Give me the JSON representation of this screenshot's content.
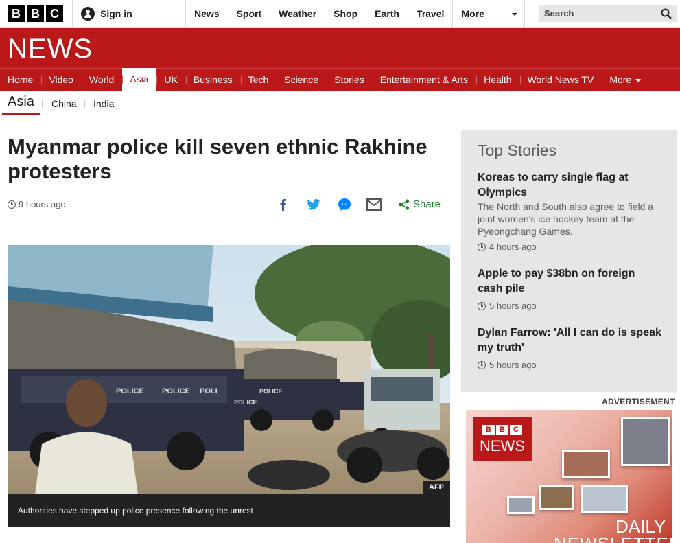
{
  "header": {
    "logo_letters": [
      "B",
      "B",
      "C"
    ],
    "sign_in": "Sign in",
    "nav": [
      "News",
      "Sport",
      "Weather",
      "Shop",
      "Earth",
      "Travel",
      "More"
    ],
    "search_placeholder": "Search"
  },
  "banner": {
    "title": "NEWS"
  },
  "section_nav": {
    "items": [
      "Home",
      "Video",
      "World",
      "Asia",
      "UK",
      "Business",
      "Tech",
      "Science",
      "Stories",
      "Entertainment & Arts",
      "Health",
      "World News TV",
      "More"
    ],
    "active": "Asia"
  },
  "sub_nav": {
    "section": "Asia",
    "links": [
      "China",
      "India"
    ]
  },
  "article": {
    "headline": "Myanmar police kill seven ethnic Rakhine protesters",
    "timestamp": "9 hours ago",
    "share_label": "Share",
    "share_icons": [
      "facebook-icon",
      "twitter-icon",
      "messenger-icon",
      "email-icon",
      "share-icon"
    ],
    "image_credit": "AFP",
    "caption": "Authorities have stepped up police presence following the unrest",
    "image_text": [
      "POLICE",
      "POLICE",
      "POLI",
      "POLICE",
      "POLICE"
    ]
  },
  "top_stories": {
    "title": "Top Stories",
    "stories": [
      {
        "headline": "Koreas to carry single flag at Olympics",
        "summary": "The North and South also agree to field a joint women's ice hockey team at the Pyeongchang Games.",
        "time": "4 hours ago"
      },
      {
        "headline": "Apple to pay $38bn on foreign cash pile",
        "summary": "",
        "time": "5 hours ago"
      },
      {
        "headline": "Dylan Farrow: 'All I can do is speak my truth'",
        "summary": "",
        "time": "5 hours ago"
      }
    ]
  },
  "advertisement": {
    "label": "ADVERTISEMENT",
    "logo_letters": [
      "B",
      "B",
      "C"
    ],
    "logo_word": "NEWS",
    "line1": "DAILY",
    "line2": "NEWSLETTER"
  },
  "colors": {
    "brand_red": "#bb1919",
    "share_green": "#1b7d2b",
    "panel_grey": "#e6e6e6"
  }
}
